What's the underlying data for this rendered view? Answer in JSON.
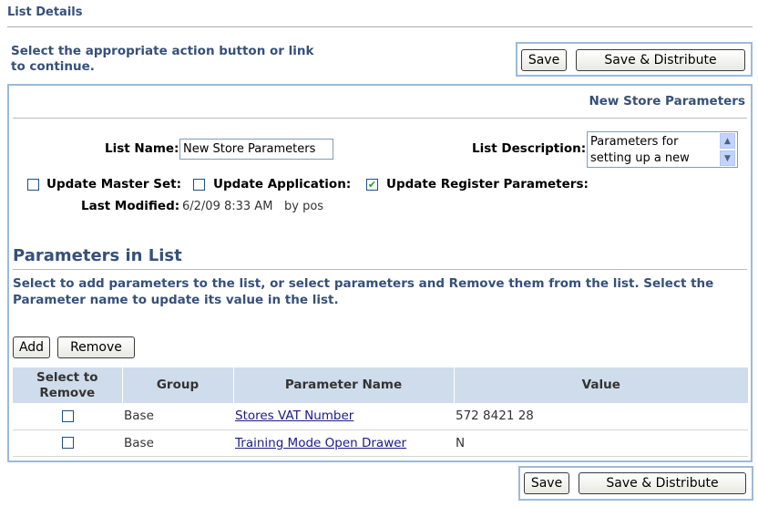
{
  "page": {
    "title": "List Details",
    "instructions": "Select the appropriate action button or link to continue."
  },
  "actions": {
    "save_label": "Save",
    "save_distribute_label": "Save & Distribute"
  },
  "list": {
    "display_title": "New Store Parameters",
    "name_label": "List Name:",
    "name_value": "New Store Parameters",
    "description_label": "List Description:",
    "description_value": "Parameters for setting up a new",
    "update_master_set_label": "Update Master Set:",
    "update_master_set_checked": false,
    "update_application_label": "Update Application:",
    "update_application_checked": false,
    "update_register_label": "Update Register Parameters:",
    "update_register_checked": true,
    "last_modified_label": "Last Modified:",
    "last_modified_value": "6/2/09 8:33 AM",
    "last_modified_by": "by pos"
  },
  "parameters": {
    "section_title": "Parameters in List",
    "description": "Select to add parameters to the list, or select parameters and Remove them from the list. Select the Parameter name to update its value in the list.",
    "add_label": "Add",
    "remove_label": "Remove",
    "columns": {
      "select": "Select to Remove",
      "group": "Group",
      "name": "Parameter Name",
      "value": "Value"
    },
    "rows": [
      {
        "group": "Base",
        "name": "Stores VAT Number",
        "value": "572 8421 28"
      },
      {
        "group": "Base",
        "name": "Training Mode Open Drawer",
        "value": "N"
      }
    ]
  },
  "icons": {
    "checkmark": "check-icon",
    "scroll_up": "scroll-up-icon",
    "scroll_down": "scroll-down-icon"
  },
  "colors": {
    "heading": "#36507a",
    "panel_border": "#9dbad8",
    "table_header": "#cfdceb",
    "link": "#1a1a8c",
    "check": "#21a121"
  }
}
